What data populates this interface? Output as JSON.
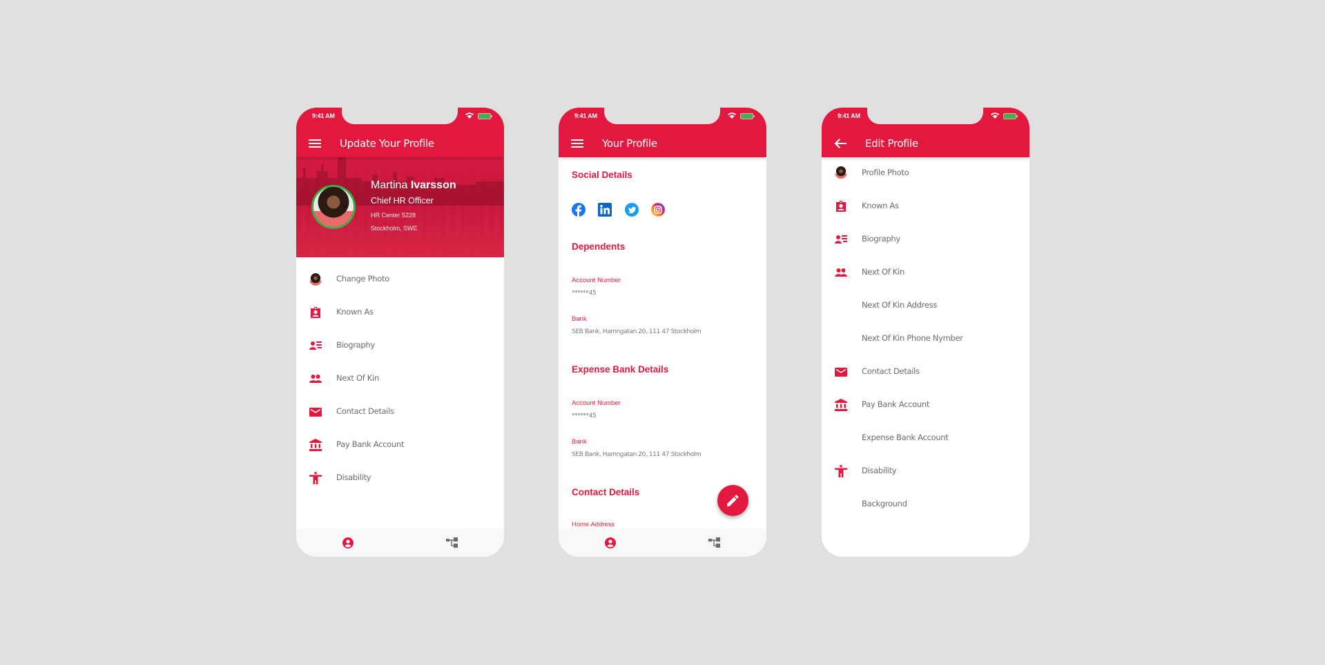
{
  "theme": {
    "accent": "#e3183e",
    "background": "#dfe0df",
    "avatar_ring": "#3aae47",
    "battery": "#3fb34f"
  },
  "status_bar": {
    "time": "9:41 AM"
  },
  "screens": [
    {
      "id": "update-profile",
      "appbar": {
        "icon": "menu-icon",
        "title": "Update Your Profile"
      },
      "profile": {
        "first_name": "Martina",
        "last_name": "Ivarsson",
        "role": "Chief HR Officer",
        "office": "HR Center 5228",
        "location": "Stockholm, SWE"
      },
      "menu": [
        {
          "icon": "avatar-icon",
          "label": "Change Photo"
        },
        {
          "icon": "badge-icon",
          "label": "Known As"
        },
        {
          "icon": "biography-icon",
          "label": "Biography"
        },
        {
          "icon": "people-icon",
          "label": "Next Of Kin"
        },
        {
          "icon": "mail-icon",
          "label": "Contact Details"
        },
        {
          "icon": "bank-icon",
          "label": "Pay Bank Account"
        },
        {
          "icon": "accessibility-icon",
          "label": "Disability"
        }
      ],
      "bottom_nav": [
        {
          "icon": "account-circle-icon",
          "active": true
        },
        {
          "icon": "org-chart-icon",
          "active": false
        }
      ]
    },
    {
      "id": "your-profile",
      "appbar": {
        "icon": "menu-icon",
        "title": "Your Profile"
      },
      "sections": {
        "social": {
          "title": "Social Details",
          "networks": [
            "facebook",
            "linkedin",
            "twitter",
            "instagram"
          ]
        },
        "dependents": {
          "title": "Dependents",
          "account_label": "Account Number",
          "account_value": "******45",
          "bank_label": "Bank",
          "bank_value": "SEB Bank, Hamngatan 20, 111 47 Stockholm"
        },
        "expense": {
          "title": "Expense Bank Details",
          "account_label": "Account Number",
          "account_value": "******45",
          "bank_label": "Bank",
          "bank_value": "SEB Bank, Hamngatan 20, 111 47 Stockholm"
        },
        "contact": {
          "title": "Contact Details",
          "home_label": "Home Address"
        }
      },
      "fab": {
        "icon": "pencil-icon"
      },
      "bottom_nav": [
        {
          "icon": "account-circle-icon",
          "active": true
        },
        {
          "icon": "org-chart-icon",
          "active": false
        }
      ]
    },
    {
      "id": "edit-profile",
      "appbar": {
        "icon": "arrow-back-icon",
        "title": "Edit Profile"
      },
      "menu": [
        {
          "icon": "avatar-icon",
          "label": "Profile Photo"
        },
        {
          "icon": "badge-icon",
          "label": "Known As"
        },
        {
          "icon": "biography-icon",
          "label": "Biography"
        },
        {
          "icon": "people-icon",
          "label": "Next Of Kin"
        },
        {
          "icon": "",
          "label": "Next Of Kin Address"
        },
        {
          "icon": "",
          "label": "Next Of Kin Phone Nymber"
        },
        {
          "icon": "mail-icon",
          "label": "Contact Details"
        },
        {
          "icon": "bank-icon",
          "label": "Pay Bank Account"
        },
        {
          "icon": "",
          "label": "Expense Bank Account"
        },
        {
          "icon": "accessibility-icon",
          "label": "Disability"
        },
        {
          "icon": "",
          "label": "Background"
        }
      ]
    }
  ]
}
